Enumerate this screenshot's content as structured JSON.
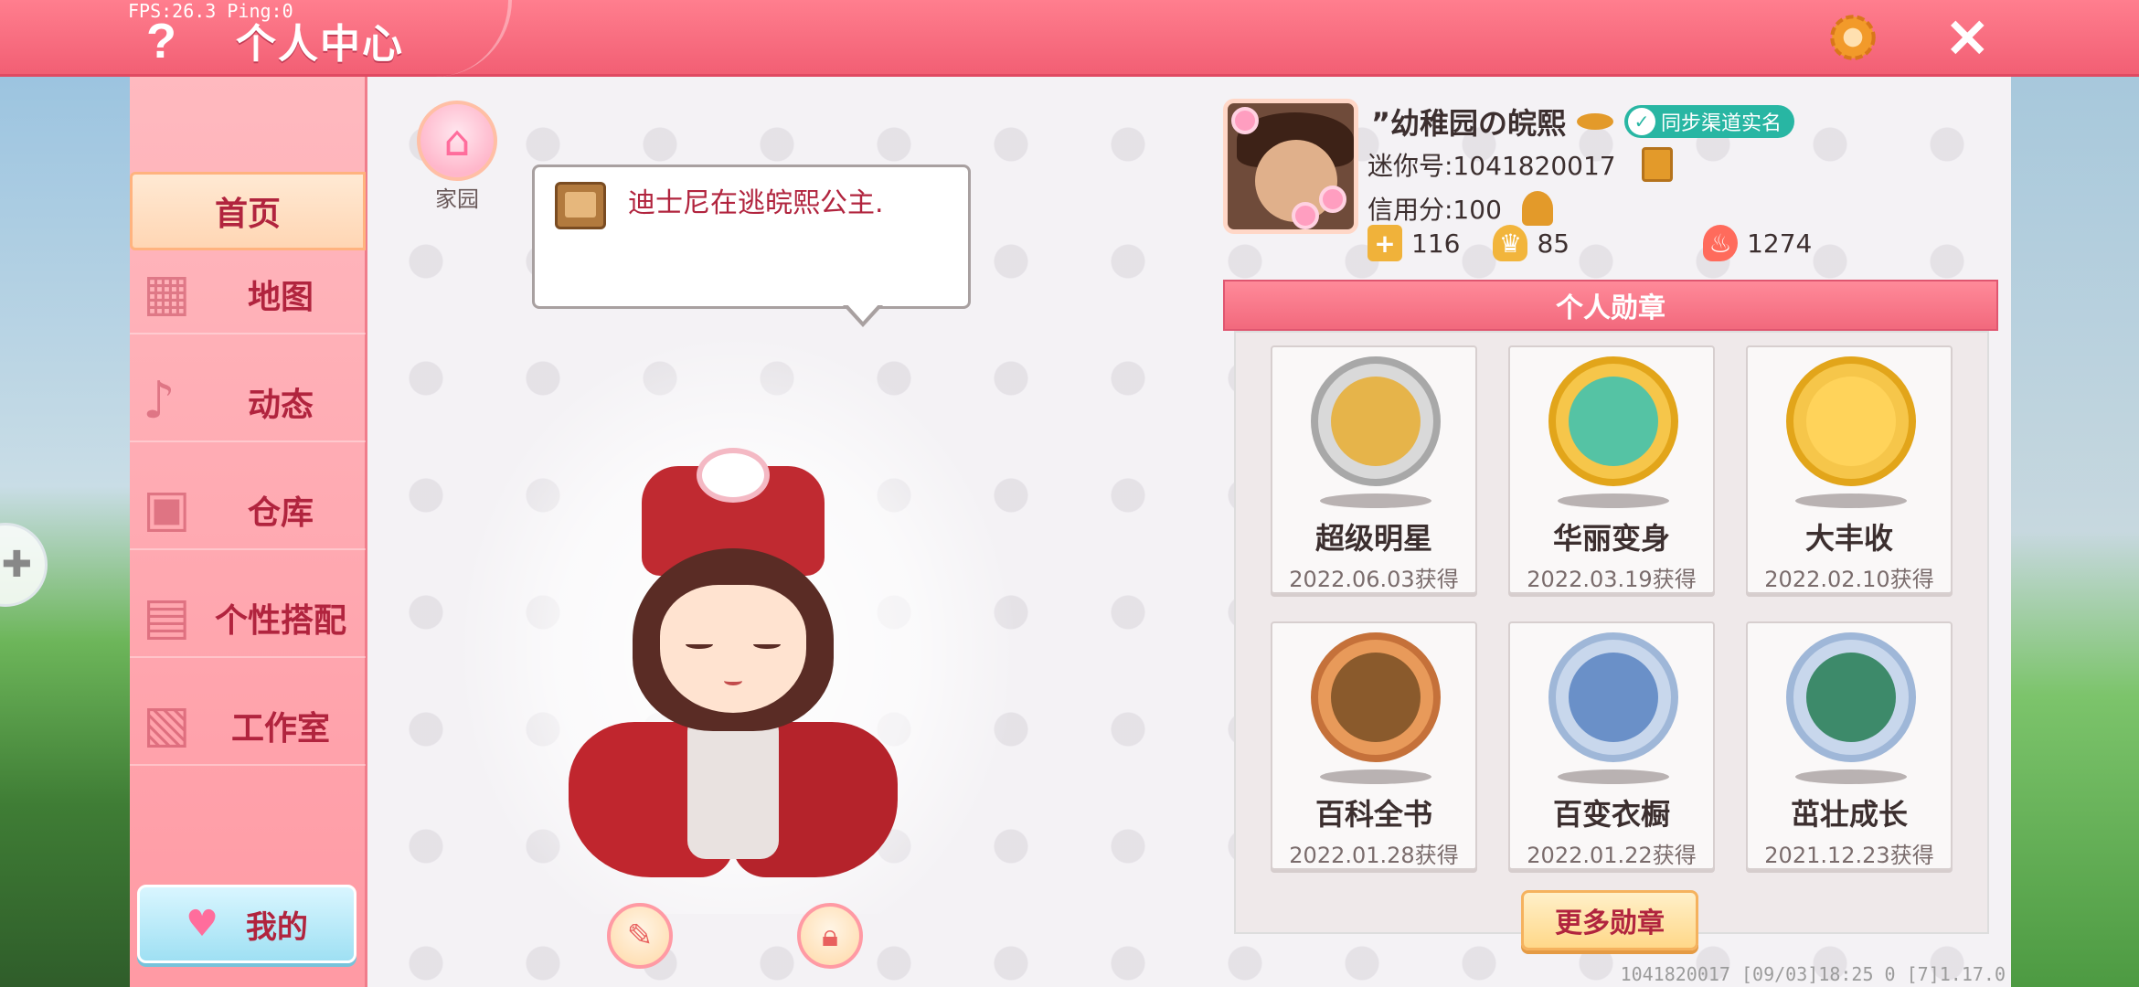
{
  "debug": {
    "fps": "FPS:26.3 Ping:0"
  },
  "header": {
    "title": "个人中心",
    "help": "?",
    "close": "✕"
  },
  "nav": {
    "items": [
      {
        "label": "首页",
        "icon": "home-tab-icon",
        "active": true
      },
      {
        "label": "地图",
        "icon": "map-icon",
        "active": false
      },
      {
        "label": "动态",
        "icon": "bell-icon",
        "active": false
      },
      {
        "label": "仓库",
        "icon": "storage-icon",
        "active": false
      },
      {
        "label": "个性搭配",
        "icon": "outfit-icon",
        "active": false
      },
      {
        "label": "工作室",
        "icon": "studio-icon",
        "active": false
      }
    ],
    "mine_label": "我的"
  },
  "home": {
    "label": "家园"
  },
  "bubble": {
    "text": "迪士尼在逃皖熙公主."
  },
  "profile": {
    "name": "”幼稚园の皖熙",
    "realname_badge": "同步渠道实名",
    "id": "迷你号:1041820017",
    "credit": "信用分:100",
    "stats": [
      {
        "icon": "flag-icon",
        "value": "116",
        "color": "#f0b23a"
      },
      {
        "icon": "trophy-icon",
        "value": "85",
        "color": "#f2b53c"
      },
      {
        "icon": "flame-icon",
        "value": "1274",
        "color": "#ff6b5c"
      }
    ]
  },
  "medals": {
    "header": "个人勋章",
    "items": [
      {
        "name": "超级明星",
        "date": "2022.06.03获得",
        "rim": "#a8a8a8",
        "core": "#e6b44a"
      },
      {
        "name": "华丽变身",
        "date": "2022.03.19获得",
        "rim": "#e2a51a",
        "core": "#55c3a4"
      },
      {
        "name": "大丰收",
        "date": "2022.02.10获得",
        "rim": "#e2a51a",
        "core": "#ffd35a"
      },
      {
        "name": "百科全书",
        "date": "2022.01.28获得",
        "rim": "#c5713a",
        "core": "#8a5a2c"
      },
      {
        "name": "百变衣橱",
        "date": "2022.01.22获得",
        "rim": "#9fb7d8",
        "core": "#6a90c8"
      },
      {
        "name": "茁壮成长",
        "date": "2021.12.23获得",
        "rim": "#9fb7d8",
        "core": "#3d8a6a"
      }
    ],
    "more_label": "更多勋章"
  },
  "footer": {
    "info": "1041820017 [09/03]18:25 0 [7]1.17.0"
  }
}
